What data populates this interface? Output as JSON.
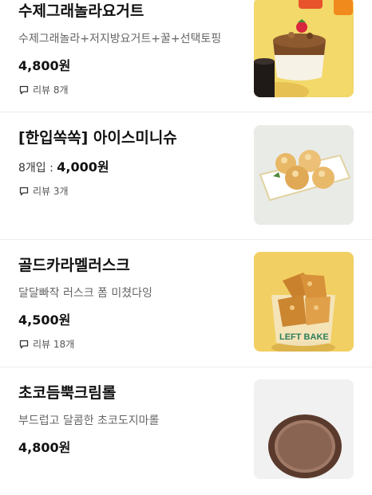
{
  "menu": {
    "items": [
      {
        "name": "수제그래놀라요거트",
        "description": "수제그래놀라+저지방요거트+꿀+선택토핑",
        "price": "4,800원",
        "reviews": "리뷰 8개",
        "thumb_bg": "#f3d86a"
      },
      {
        "name": "[한입쏙쏙] 아이스미니슈",
        "quantity_label": "8개입 : ",
        "price": "4,000원",
        "reviews": "리뷰 3개",
        "thumb_bg": "#e9ebe7"
      },
      {
        "name": "골드카라멜러스크",
        "description": "달달빠작 러스크 폼 미쳤다잉",
        "price": "4,500원",
        "reviews": "리뷰 18개",
        "thumb_bg": "#f2cf62"
      },
      {
        "name": "초코듬뿍크림롤",
        "description": "부드럽고 달콤한 초코도지마롤",
        "price": "4,800원",
        "thumb_bg": "#f1f1f1"
      }
    ]
  },
  "colors": {
    "divider": "#ededed",
    "title": "#111111",
    "description": "#666666"
  },
  "icons": {
    "review": "speech-bubble-icon"
  }
}
